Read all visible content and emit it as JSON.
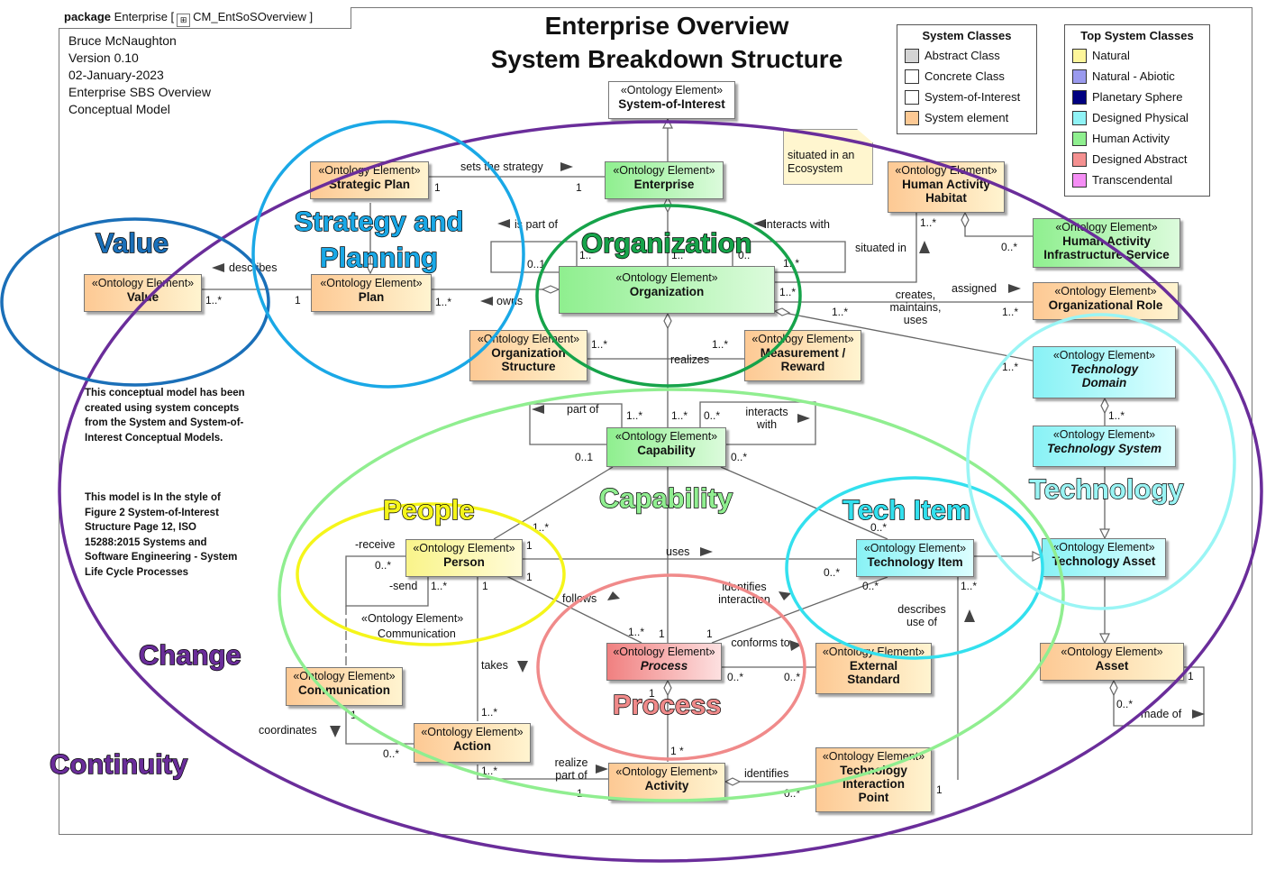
{
  "package": {
    "keyword": "package",
    "name": "Enterprise",
    "diagram": "CM_EntSoSOverview"
  },
  "meta": [
    "Bruce McNaughton",
    "Version 0.10",
    "02-January-2023",
    "Enterprise SBS Overview",
    "Conceptual Model"
  ],
  "title": [
    "Enterprise Overview",
    "System Breakdown Structure"
  ],
  "legend_system": {
    "title": "System Classes",
    "items": [
      {
        "label": "Abstract Class",
        "color": "#d4d4d4"
      },
      {
        "label": "Concrete Class",
        "color": "#ffffff"
      },
      {
        "label": "System-of-Interest",
        "color": "#ffffff"
      },
      {
        "label": "System element",
        "color": "#fdc994"
      }
    ]
  },
  "legend_top": {
    "title": "Top System Classes",
    "items": [
      {
        "label": "Natural",
        "color": "#fdf59a"
      },
      {
        "label": "Natural - Abiotic",
        "color": "#9a9aee"
      },
      {
        "label": "Planetary Sphere",
        "color": "#000080"
      },
      {
        "label": "Designed Physical",
        "color": "#8ff2f5"
      },
      {
        "label": "Human Activity",
        "color": "#8fef8f"
      },
      {
        "label": "Designed Abstract",
        "color": "#f49090"
      },
      {
        "label": "Transcendental",
        "color": "#f58ef5"
      }
    ]
  },
  "stereotype": "«Ontology Element»",
  "elements": {
    "soi": "System-of-Interest",
    "strategic_plan": "Strategic Plan",
    "enterprise": "Enterprise",
    "habitat": "Human Activity Habitat",
    "infra": "Human Activity Infrastructure Service",
    "value": "Value",
    "plan": "Plan",
    "organization": "Organization",
    "org_role": "Organizational Role",
    "org_structure": "Organization Structure",
    "measurement": "Measurement / Reward",
    "tech_domain": "Technology Domain",
    "capability": "Capability",
    "tech_system": "Technology System",
    "person": "Person",
    "tech_item": "Technology Item",
    "tech_asset": "Technology Asset",
    "communication": "Communication",
    "process": "Process",
    "ext_standard": "External Standard",
    "asset": "Asset",
    "action": "Action",
    "activity": "Activity",
    "tip": "Technology Interaction Point"
  },
  "note": "situated in an Ecosystem",
  "relations": {
    "sets_strategy": "sets the strategy",
    "is_part_of": "is part of",
    "interacts_with": "interacts with",
    "situated_in": "situated in",
    "describes": "describes",
    "owns": "owns",
    "creates": "creates, maintains, uses",
    "assigned": "assigned",
    "realizes": "realizes",
    "part_of": "part of",
    "interacts_with2": "interacts with",
    "uses": "uses",
    "receive": "-receive",
    "send": "-send",
    "follows": "follows",
    "identifies_interaction": "identifies interaction",
    "describes_use_of": "describes use of",
    "conforms_to": "conforms to",
    "takes": "takes",
    "coordinates": "coordinates",
    "realize_part_of": "realize part of",
    "identifies": "identifies",
    "made_of": "made of",
    "communication_assoc": "Communication"
  },
  "multiplicities": {
    "m_sp1": "1",
    "m_ent1": "1",
    "m_val": "1..*",
    "m_plan1": "1",
    "m_plan2": "1..*",
    "m_ispart1": "0..1",
    "m_ispart2": "1..",
    "m_org_a": "1..",
    "m_org_b": "0..",
    "m_iw": "1..*",
    "m_hab": "1..*",
    "m_infra": "0..*",
    "m_org_sit": "1..*",
    "m_org_cr": "1..*",
    "m_role": "1..*",
    "m_td": "1..*",
    "m_os": "1..*",
    "m_mr": "1..*",
    "m_ts": "1..*",
    "m_cap_p1": "1..*",
    "m_cap_p2": "1..*",
    "m_cap_i": "0..*",
    "m_cap_01": "0..1",
    "m_cap_0s": "0..*",
    "m_per_cap": "1..*",
    "m_ti_cap": "0..*",
    "m_per_1a": "1",
    "m_per_1b": "1",
    "m_ti_0a": "0..*",
    "m_ti_0b": "0..*",
    "m_ti_1s": "1..*",
    "m_recv": "0..*",
    "m_send": "1..*",
    "m_per_act": "1",
    "m_proc_1s": "1..*",
    "m_proc_1": "1",
    "m_proc_1b": "1",
    "m_proc_0s": "0..*",
    "m_es_0s": "0..*",
    "m_proc_act": "1",
    "m_act_proc": "1 *",
    "m_comm1": "1",
    "m_action_0": "0..*",
    "m_action_1s": "1..*",
    "m_action_top": "1..*",
    "m_act_1": "1",
    "m_tip_0": "0..*",
    "m_tip_1": "1",
    "m_asset_0s": "0..*",
    "m_asset_1": "1"
  },
  "notes": [
    "This conceptual model has been created using system concepts from the System and System-of-Interest Conceptual Models.",
    "This model is In the style of Figure 2 System-of-Interest Structure Page 12, ISO 15288:2015 Systems and Software Engineering - System Life Cycle Processes"
  ],
  "regions": {
    "value": {
      "label": "Value",
      "color": "#1a6fb8"
    },
    "strategy": {
      "label": "Strategy and Planning",
      "color": "#1aa8e6"
    },
    "organization": {
      "label": "Organization",
      "color": "#16a34a"
    },
    "capability": {
      "label": "Capability",
      "color": "#90ee90"
    },
    "people": {
      "label": "People",
      "color": "#f5f51a"
    },
    "tech_item": {
      "label": "Tech Item",
      "color": "#33e0ee"
    },
    "technology": {
      "label": "Technology",
      "color": "#9af5f5"
    },
    "process": {
      "label": "Process",
      "color": "#f08a8a"
    },
    "change": {
      "label": "Change",
      "color": "#6a2d9a"
    },
    "continuity": {
      "label": "Continuity",
      "color": "#6a2d9a"
    }
  }
}
